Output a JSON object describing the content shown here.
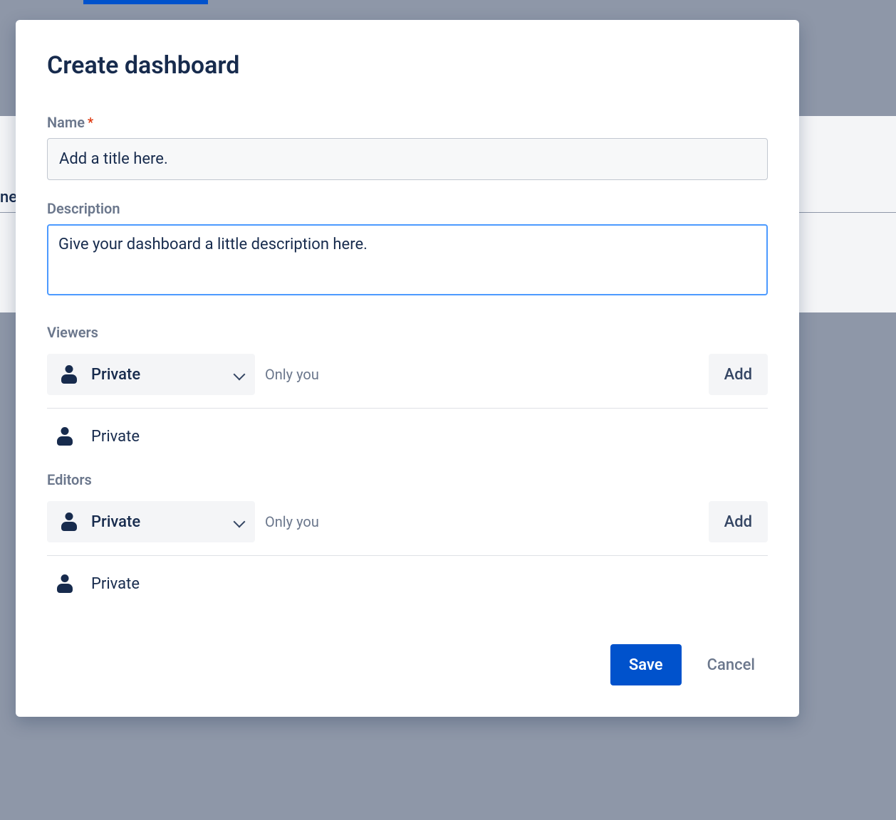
{
  "modal": {
    "title": "Create dashboard",
    "name": {
      "label": "Name",
      "required_mark": "*",
      "value": "Add a title here."
    },
    "description": {
      "label": "Description",
      "value": "Give your dashboard a little description here."
    },
    "viewers": {
      "label": "Viewers",
      "dropdown_value": "Private",
      "hint": "Only you",
      "add_label": "Add",
      "entry_label": "Private"
    },
    "editors": {
      "label": "Editors",
      "dropdown_value": "Private",
      "hint": "Only you",
      "add_label": "Add",
      "entry_label": "Private"
    },
    "actions": {
      "save": "Save",
      "cancel": "Cancel"
    }
  },
  "backdrop": {
    "fragment": "ne"
  }
}
